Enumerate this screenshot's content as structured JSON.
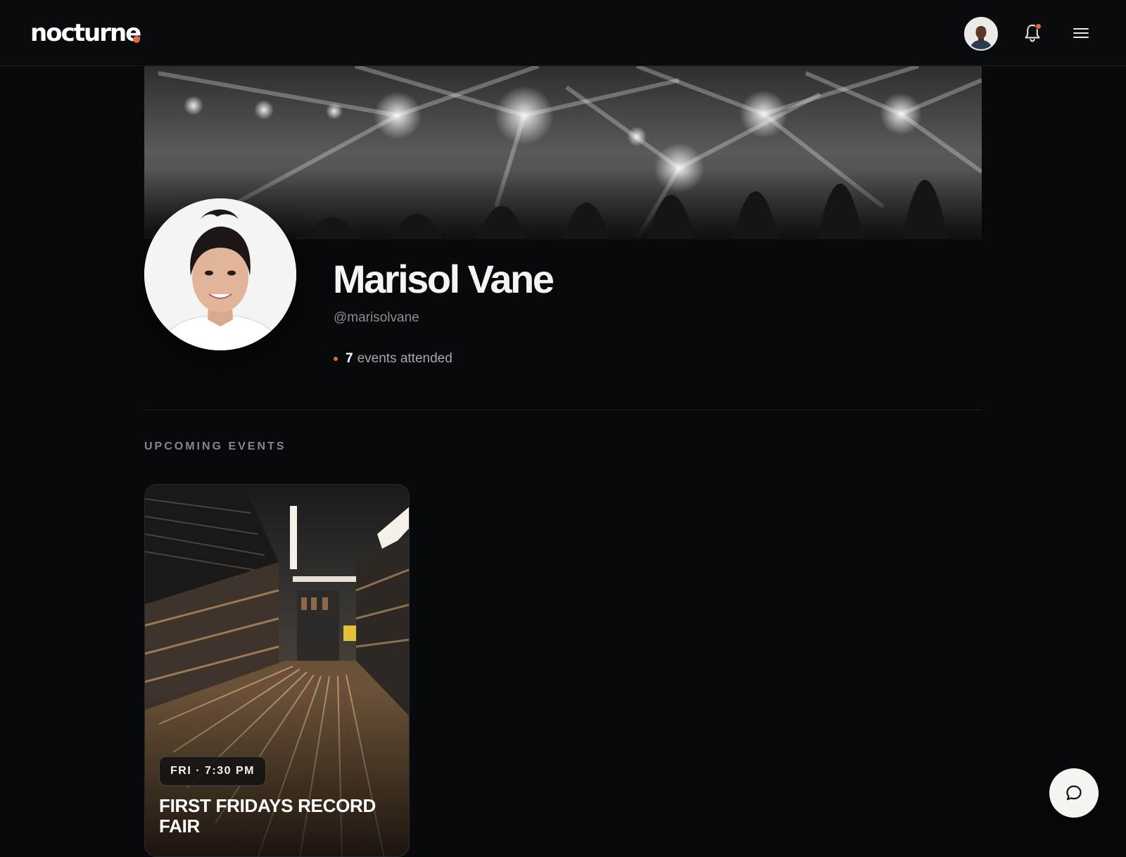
{
  "app": {
    "brand": "nocturne",
    "accent_color": "#e8643f"
  },
  "header": {
    "user_avatar_icon": "user-avatar",
    "notifications_icon": "bell-icon",
    "has_unread_notifications": true,
    "menu_icon": "hamburger-menu-icon"
  },
  "profile": {
    "name": "Marisol Vane",
    "handle": "@marisolvane",
    "events_attended_count": "7",
    "events_attended_label": "events attended"
  },
  "upcoming": {
    "section_title": "UPCOMING EVENTS",
    "events": [
      {
        "time": "FRI · 7:30 PM",
        "title": "FIRST FRIDAYS RECORD FAIR"
      }
    ]
  },
  "chat": {
    "icon": "chat-bubble-icon"
  }
}
